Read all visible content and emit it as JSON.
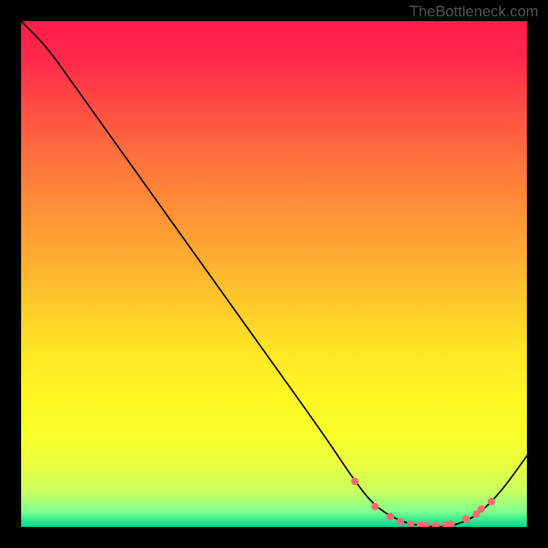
{
  "watermark": "TheBottleneck.com",
  "chart_data": {
    "type": "line",
    "title": "",
    "xlabel": "",
    "ylabel": "",
    "xlim": [
      0,
      100
    ],
    "ylim": [
      0,
      100
    ],
    "series": [
      {
        "name": "curve",
        "x": [
          0,
          5,
          10,
          20,
          30,
          40,
          50,
          60,
          66,
          70,
          75,
          80,
          85,
          90,
          95,
          100
        ],
        "y": [
          100,
          95,
          88,
          74,
          60,
          46,
          32,
          18,
          9,
          4,
          1,
          0,
          0,
          2,
          7,
          14
        ]
      }
    ],
    "markers": {
      "name": "dots",
      "x": [
        66,
        70,
        73,
        75,
        77,
        79,
        80,
        82,
        84,
        85,
        88,
        90,
        91,
        93
      ],
      "y": [
        9,
        4,
        2,
        1,
        0.5,
        0.3,
        0.2,
        0.2,
        0.3,
        0.5,
        1.5,
        2.5,
        3.5,
        5
      ]
    },
    "background_gradient": {
      "top": "#ff1a4d",
      "upper_mid": "#ff8a38",
      "mid": "#ffe824",
      "lower_mid": "#e8ff40",
      "bottom": "#00d898"
    }
  }
}
